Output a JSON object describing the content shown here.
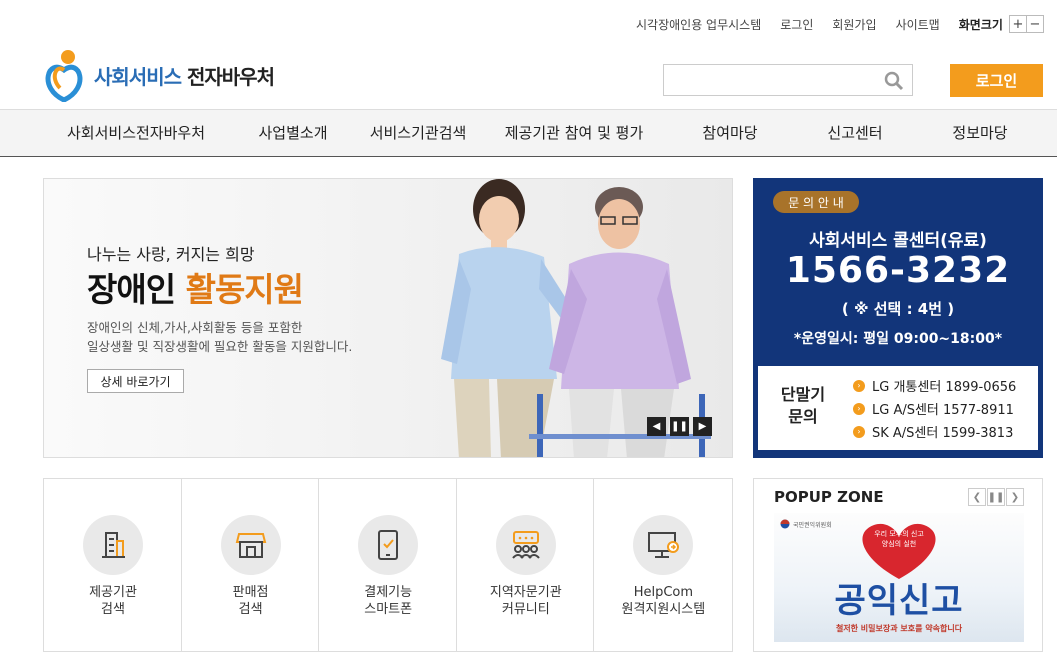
{
  "util": {
    "links": [
      "시각장애인용 업무시스템",
      "로그인",
      "회원가입",
      "사이트맵"
    ],
    "zoom_label": "화면크기",
    "zoom_in": "+",
    "zoom_out": "−"
  },
  "header": {
    "logo_blue": "사회서비스",
    "logo_rest": " 전자바우처",
    "search_placeholder": "",
    "login_label": "로그인"
  },
  "nav": {
    "items": [
      "사회서비스전자바우처",
      "사업별소개",
      "서비스기관검색",
      "제공기관 참여 및 평가",
      "참여마당",
      "신고센터",
      "정보마당"
    ]
  },
  "banner": {
    "subtitle": "나누는 사랑, 커지는 희망",
    "title_black": "장애인 ",
    "title_orange": "활동지원",
    "desc_line1": "장애인의 신체,가사,사회활동 등을 포함한",
    "desc_line2": "일상생활 및 직장생활에 필요한 활동을 지원합니다.",
    "more_label": "상세 바로가기",
    "prev": "◀",
    "pause": "❚❚",
    "next": "▶"
  },
  "callcenter": {
    "badge": "문 의 안 내",
    "title": "사회서비스 콜센터(유료)",
    "number": "1566-3232",
    "selection": "( ※ 선택 : 4번 )",
    "hours": "*운영일시: 평일 09:00~18:00*",
    "device_label_1": "단말기",
    "device_label_2": "문의",
    "lines": [
      "LG 개통센터 1899-0656",
      "LG A/S센터 1577-8911",
      "SK A/S센터 1599-3813"
    ],
    "colors": {
      "bg": "#12357a",
      "accent": "#f39c1d"
    }
  },
  "quick": {
    "items": [
      {
        "line1": "제공기관",
        "line2": "검색",
        "icon": "building-icon"
      },
      {
        "line1": "판매점",
        "line2": "검색",
        "icon": "store-icon"
      },
      {
        "line1": "결제기능",
        "line2": "스마트폰",
        "icon": "smartphone-icon"
      },
      {
        "line1": "지역자문기관",
        "line2": "커뮤니티",
        "icon": "community-icon"
      },
      {
        "line1": "HelpCom",
        "line2": "원격지원시스템",
        "icon": "remote-monitor-icon"
      }
    ]
  },
  "popup": {
    "title": "POPUP ZONE",
    "prev": "❮",
    "pause": "❚❚",
    "next": "❯",
    "banner_heart_line1": "우리 모두의 신고",
    "banner_heart_line2": "양심의 실천",
    "banner_org": "국민권익위원회",
    "banner_text": "공익신고",
    "banner_sub": "철저한 비밀보장과 보호를 약속합니다"
  }
}
